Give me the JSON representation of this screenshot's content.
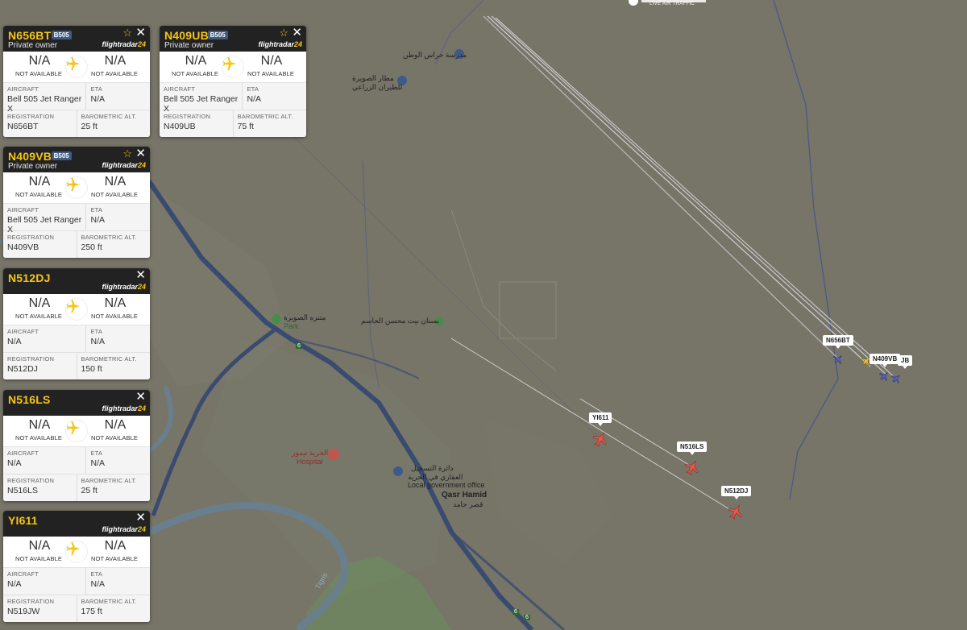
{
  "colors": {
    "map_bg": "#777468",
    "card_header": "#222222",
    "callsign": "#f5c518",
    "plane_map": "#e8574a",
    "badge": "#3d5a80",
    "road": "#3a4b70",
    "river": "#6a7f8d"
  },
  "logo": {
    "tagline": "LIVE AIR TRAFFIC"
  },
  "cards": [
    {
      "callsign": "N656BT",
      "badge": "B505",
      "owner": "Private owner",
      "brand_a": "flightradar",
      "brand_b": "24",
      "origin": "N/A",
      "origin_sub": "NOT AVAILABLE",
      "dest": "N/A",
      "dest_sub": "NOT AVAILABLE",
      "aircraft_label": "AIRCRAFT",
      "aircraft": "Bell 505 Jet Ranger X",
      "eta_label": "ETA",
      "eta": "N/A",
      "reg_label": "REGISTRATION",
      "registration": "N656BT",
      "alt_label": "BAROMETRIC ALT.",
      "altitude": "25 ft"
    },
    {
      "callsign": "N409UB",
      "badge": "B505",
      "owner": "Private owner",
      "brand_a": "flightradar",
      "brand_b": "24",
      "origin": "N/A",
      "origin_sub": "NOT AVAILABLE",
      "dest": "N/A",
      "dest_sub": "NOT AVAILABLE",
      "aircraft_label": "AIRCRAFT",
      "aircraft": "Bell 505 Jet Ranger X",
      "eta_label": "ETA",
      "eta": "N/A",
      "reg_label": "REGISTRATION",
      "registration": "N409UB",
      "alt_label": "BAROMETRIC ALT.",
      "altitude": "75 ft"
    },
    {
      "callsign": "N409VB",
      "badge": "B505",
      "owner": "Private owner",
      "brand_a": "flightradar",
      "brand_b": "24",
      "origin": "N/A",
      "origin_sub": "NOT AVAILABLE",
      "dest": "N/A",
      "dest_sub": "NOT AVAILABLE",
      "aircraft_label": "AIRCRAFT",
      "aircraft": "Bell 505 Jet Ranger X",
      "eta_label": "ETA",
      "eta": "N/A",
      "reg_label": "REGISTRATION",
      "registration": "N409VB",
      "alt_label": "BAROMETRIC ALT.",
      "altitude": "250 ft"
    },
    {
      "callsign": "N512DJ",
      "badge": "",
      "owner": "",
      "brand_a": "flightradar",
      "brand_b": "24",
      "origin": "N/A",
      "origin_sub": "NOT AVAILABLE",
      "dest": "N/A",
      "dest_sub": "NOT AVAILABLE",
      "aircraft_label": "AIRCRAFT",
      "aircraft": "N/A",
      "eta_label": "ETA",
      "eta": "N/A",
      "reg_label": "REGISTRATION",
      "registration": "N512DJ",
      "alt_label": "BAROMETRIC ALT.",
      "altitude": "150 ft"
    },
    {
      "callsign": "N516LS",
      "badge": "",
      "owner": "",
      "brand_a": "flightradar",
      "brand_b": "24",
      "origin": "N/A",
      "origin_sub": "NOT AVAILABLE",
      "dest": "N/A",
      "dest_sub": "NOT AVAILABLE",
      "aircraft_label": "AIRCRAFT",
      "aircraft": "N/A",
      "eta_label": "ETA",
      "eta": "N/A",
      "reg_label": "REGISTRATION",
      "registration": "N516LS",
      "alt_label": "BAROMETRIC ALT.",
      "altitude": "25 ft"
    },
    {
      "callsign": "YI611",
      "badge": "",
      "owner": "",
      "brand_a": "flightradar",
      "brand_b": "24",
      "origin": "N/A",
      "origin_sub": "NOT AVAILABLE",
      "dest": "N/A",
      "dest_sub": "NOT AVAILABLE",
      "aircraft_label": "AIRCRAFT",
      "aircraft": "N/A",
      "eta_label": "ETA",
      "eta": "N/A",
      "reg_label": "REGISTRATION",
      "registration": "N519JW",
      "alt_label": "BAROMETRIC ALT.",
      "altitude": "175 ft"
    }
  ],
  "map_labels": {
    "n656bt": "N656BT",
    "n409vb": "N409VB",
    "n409ub_partial": "JB",
    "yi611": "YI611",
    "n516ls": "N516LS",
    "n512dj": "N512DJ"
  },
  "places": {
    "school_ar": "مدرسة حراس الوطن",
    "airport_ar_1": "مطار الصويرة",
    "airport_ar_2": "للطيران الزراعي",
    "park_ar": "متنزه الصويرة",
    "park_en": "Park",
    "orchard_ar": "بستان بيت محسن الجاسم",
    "hospital_ar": "الحرية تيموز",
    "hospital_en": "Hospital",
    "office_ar_1": "دائرة التسجيل",
    "office_ar_2": "العقاري في الحرية",
    "office_en": "Local government office",
    "town_en": "Qasr Hamid",
    "town_ar": "قصر حامد",
    "river": "Tigris",
    "road_6a": "6",
    "road_6b": "6",
    "road_6c": "6"
  }
}
